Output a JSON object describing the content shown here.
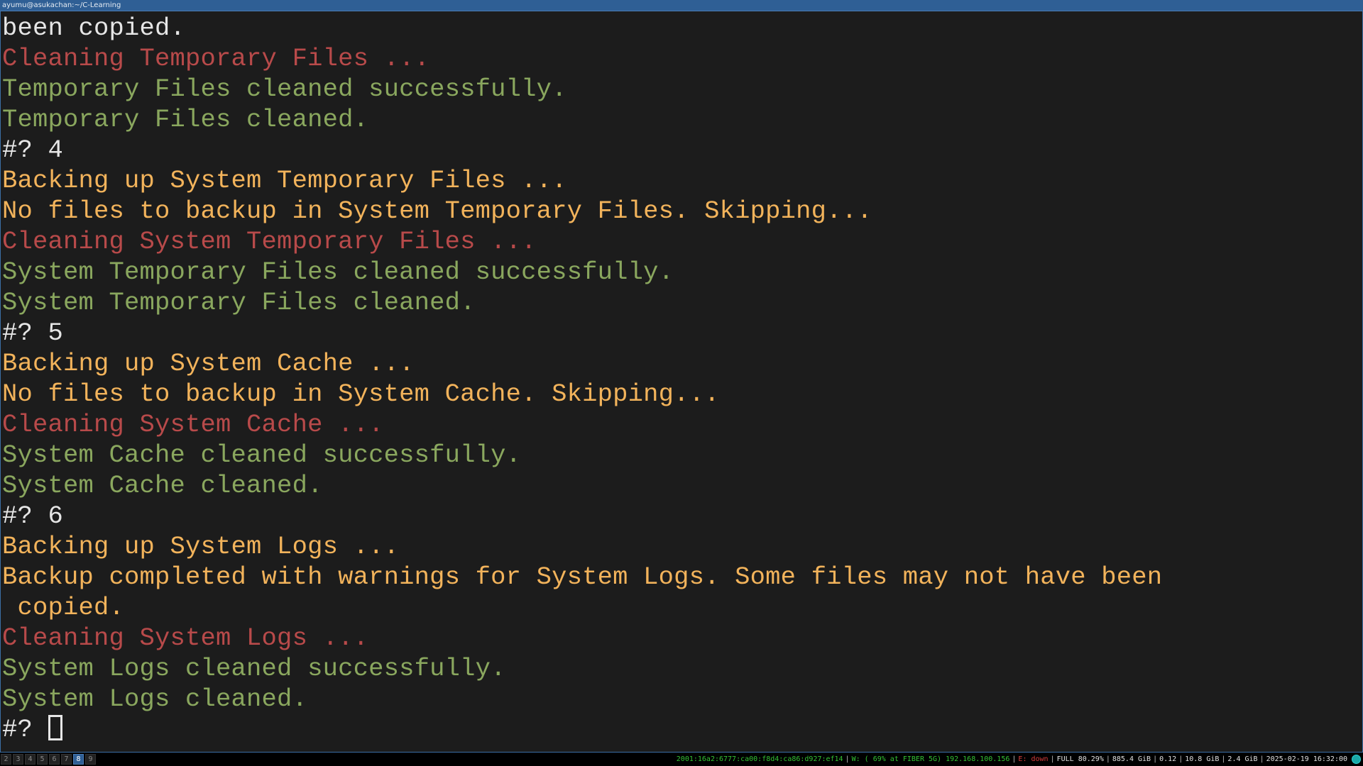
{
  "window": {
    "title": "ayumu@asukachan:~/C-Learning"
  },
  "terminal": {
    "lines": [
      {
        "text": "been copied.",
        "color": "default"
      },
      {
        "text": "Cleaning Temporary Files ...",
        "color": "red"
      },
      {
        "text": "Temporary Files cleaned successfully.",
        "color": "green"
      },
      {
        "text": "Temporary Files cleaned.",
        "color": "green"
      },
      {
        "text": "#? 4",
        "color": "default"
      },
      {
        "text": "Backing up System Temporary Files ...",
        "color": "yellow"
      },
      {
        "text": "No files to backup in System Temporary Files. Skipping...",
        "color": "yellow"
      },
      {
        "text": "Cleaning System Temporary Files ...",
        "color": "red"
      },
      {
        "text": "System Temporary Files cleaned successfully.",
        "color": "green"
      },
      {
        "text": "System Temporary Files cleaned.",
        "color": "green"
      },
      {
        "text": "#? 5",
        "color": "default"
      },
      {
        "text": "Backing up System Cache ...",
        "color": "yellow"
      },
      {
        "text": "No files to backup in System Cache. Skipping...",
        "color": "yellow"
      },
      {
        "text": "Cleaning System Cache ...",
        "color": "red"
      },
      {
        "text": "System Cache cleaned successfully.",
        "color": "green"
      },
      {
        "text": "System Cache cleaned.",
        "color": "green"
      },
      {
        "text": "#? 6",
        "color": "default"
      },
      {
        "text": "Backing up System Logs ...",
        "color": "yellow"
      },
      {
        "text": "Backup completed with warnings for System Logs. Some files may not have been",
        "color": "yellow"
      },
      {
        "text": " copied.",
        "color": "yellow"
      },
      {
        "text": "Cleaning System Logs ...",
        "color": "red"
      },
      {
        "text": "System Logs cleaned successfully.",
        "color": "green"
      },
      {
        "text": "System Logs cleaned.",
        "color": "green"
      }
    ],
    "prompt": "#? "
  },
  "colors": {
    "default": "#e6e6e6",
    "yellow": "#f2b35b",
    "red": "#b84a4a",
    "green": "#8aa75e",
    "background": "#1c1c1c",
    "accent": "#2f5f95"
  },
  "statusbar": {
    "workspaces": [
      "2",
      "3",
      "4",
      "5",
      "6",
      "7",
      "8",
      "9"
    ],
    "active_workspace": "8",
    "ipv6": "2001:16a2:6777:ca00:f8d4:ca86:d927:ef14",
    "wifi": "W: ( 69% at FIBER 5G) 192.168.100.156",
    "ethernet": "E: down",
    "disk": "FULL 80.29%",
    "disk_free": "885.4 GiB",
    "load": "0.12",
    "memory": "10.8 GiB",
    "swap": "2.4 GiB",
    "datetime": "2025-02-19 16:32:00",
    "tray_icon": "network-tray-icon"
  }
}
